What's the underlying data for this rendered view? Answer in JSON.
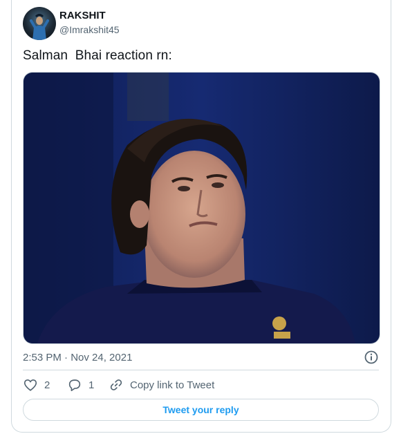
{
  "tweet": {
    "author": {
      "display_name": "RAKSHIT",
      "handle": "@Imrakshit45",
      "avatar_icon": "avatar-photo"
    },
    "text": "Salman  Bhai reaction rn:",
    "media": {
      "kind": "photo",
      "subject": "man-in-dark-tshirt"
    },
    "timestamp": "2:53 PM · Nov 24, 2021",
    "actions": {
      "like_count": "2",
      "reply_count": "1",
      "copy_link_label": "Copy link to Tweet"
    },
    "reply_button_label": "Tweet your reply"
  },
  "colors": {
    "text_primary": "#0f1419",
    "text_secondary": "#536471",
    "accent": "#1d9bf0",
    "border": "#cfd9de"
  }
}
